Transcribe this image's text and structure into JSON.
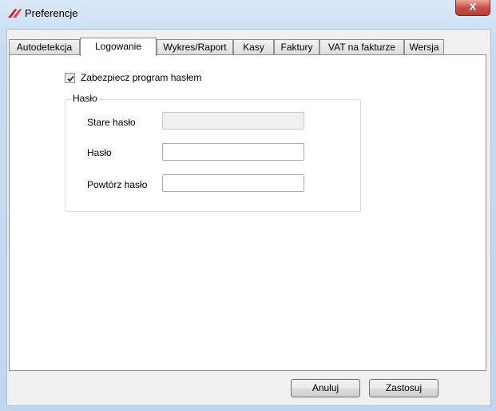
{
  "window": {
    "title": "Preferencje",
    "close_symbol": "X"
  },
  "tabs": [
    {
      "label": "Autodetekcja",
      "active": false
    },
    {
      "label": "Logowanie",
      "active": true
    },
    {
      "label": "Wykres/Raport",
      "active": false
    },
    {
      "label": "Kasy",
      "active": false
    },
    {
      "label": "Faktury",
      "active": false
    },
    {
      "label": "VAT na fakturze",
      "active": false
    },
    {
      "label": "Wersja",
      "active": false
    }
  ],
  "login": {
    "protect_checkbox": {
      "label": "Zabezpiecz program hasłem",
      "checked": true
    },
    "group_title": "Hasło",
    "fields": [
      {
        "label": "Stare hasło",
        "value": "",
        "enabled": false
      },
      {
        "label": "Hasło",
        "value": "",
        "enabled": true
      },
      {
        "label": "Powtórz hasło",
        "value": "",
        "enabled": true
      }
    ]
  },
  "buttons": {
    "cancel": "Anuluj",
    "apply": "Zastosuj"
  },
  "colors": {
    "titlebar": "#c6dcf2",
    "close_button": "#c75050",
    "tab_page_bg": "#ffffff",
    "client_bg": "#f0f0f0"
  }
}
